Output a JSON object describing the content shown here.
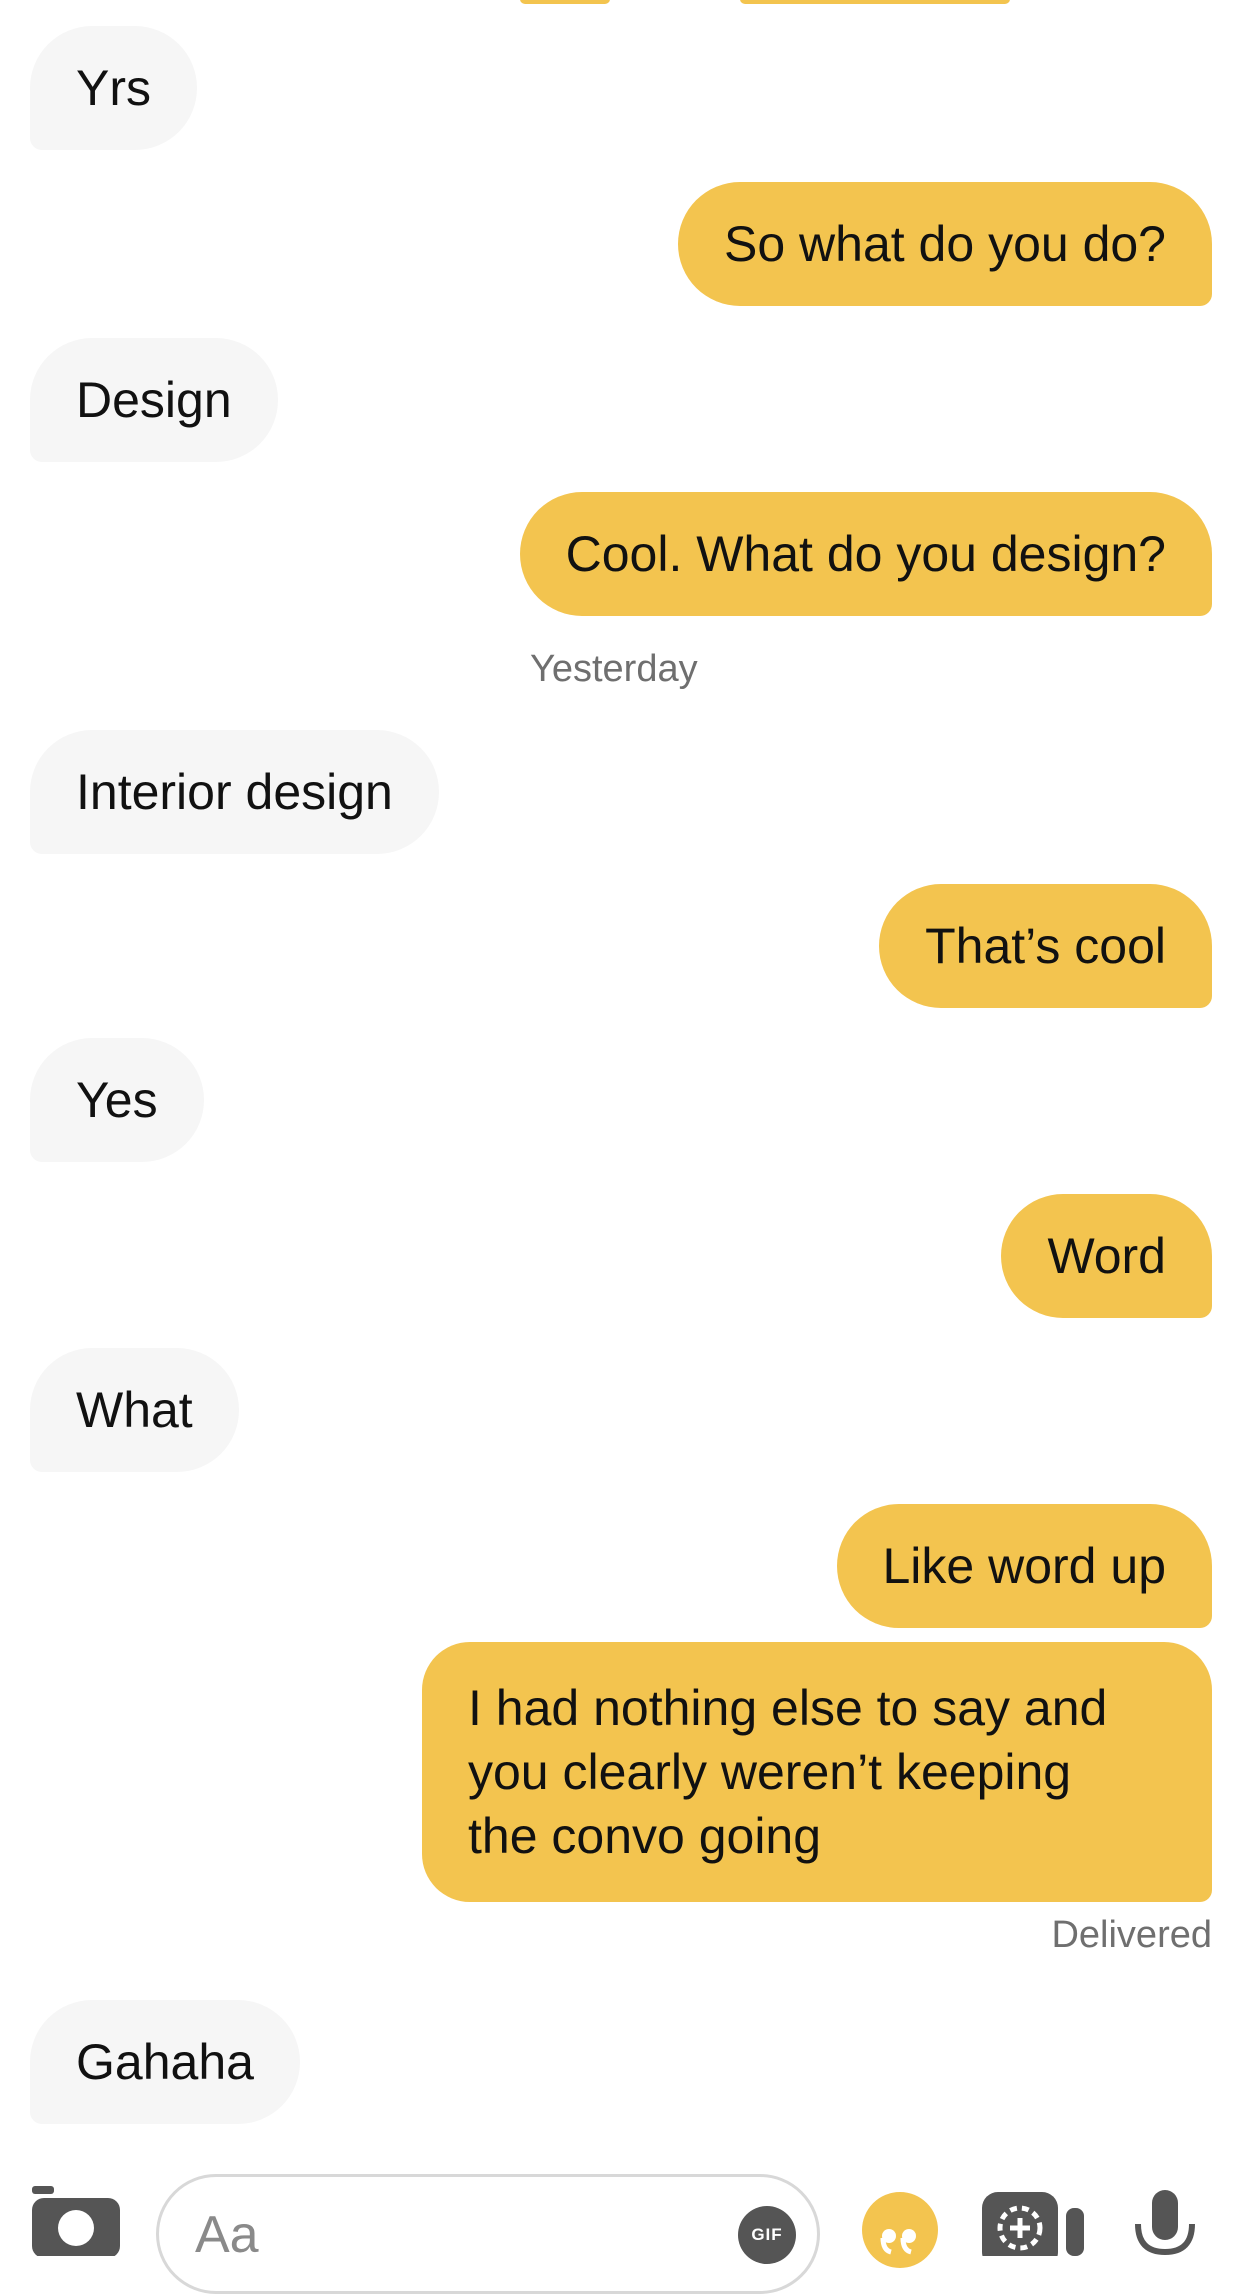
{
  "colors": {
    "outgoing_bubble": "#f3c44f",
    "incoming_bubble": "#f6f6f6",
    "timestamp_text": "#6f6f6f",
    "icon_gray": "#555555"
  },
  "messages": [
    {
      "direction": "incoming",
      "text": "Yrs"
    },
    {
      "direction": "outgoing",
      "text": "So what do you do?"
    },
    {
      "direction": "incoming",
      "text": "Design"
    },
    {
      "direction": "outgoing",
      "text": "Cool. What do you design?"
    },
    {
      "direction": "incoming",
      "text": "Interior design"
    },
    {
      "direction": "outgoing",
      "text": "That’s cool"
    },
    {
      "direction": "incoming",
      "text": "Yes"
    },
    {
      "direction": "outgoing",
      "text": "Word"
    },
    {
      "direction": "incoming",
      "text": "What"
    },
    {
      "direction": "outgoing",
      "text": "Like word up"
    },
    {
      "direction": "outgoing",
      "lines": [
        "I had nothing else to say and",
        "you clearly weren’t keeping",
        "the convo going"
      ]
    },
    {
      "direction": "incoming",
      "text": "Gahaha"
    }
  ],
  "timestamp_separator": "Yesterday",
  "delivery_status": "Delivered",
  "composer": {
    "placeholder": "Aa",
    "gif_label": "GIF",
    "icons": [
      "camera-icon",
      "gif-icon",
      "quote-icon",
      "add-media-icon",
      "microphone-icon"
    ]
  }
}
